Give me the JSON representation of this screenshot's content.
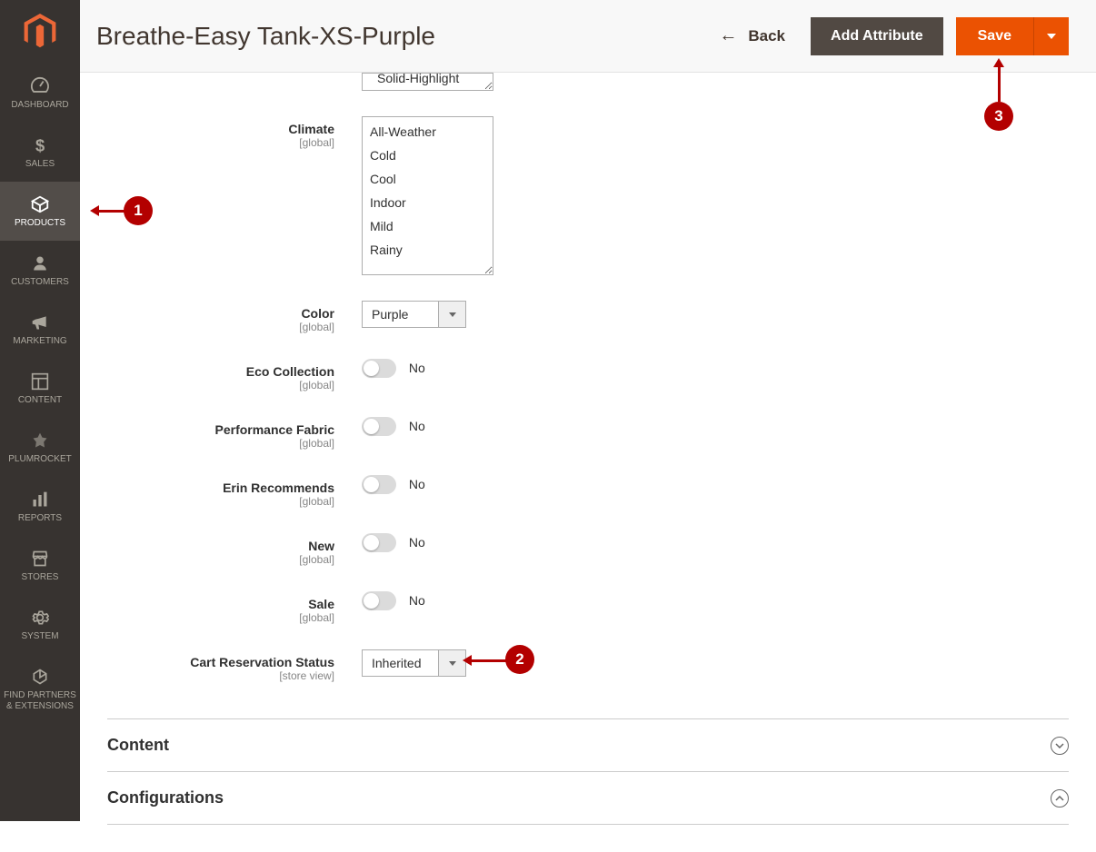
{
  "sidebar": {
    "items": [
      {
        "label": "DASHBOARD"
      },
      {
        "label": "SALES"
      },
      {
        "label": "PRODUCTS"
      },
      {
        "label": "CUSTOMERS"
      },
      {
        "label": "MARKETING"
      },
      {
        "label": "CONTENT"
      },
      {
        "label": "PLUMROCKET"
      },
      {
        "label": "REPORTS"
      },
      {
        "label": "STORES"
      },
      {
        "label": "SYSTEM"
      },
      {
        "label": "FIND PARTNERS & EXTENSIONS"
      }
    ]
  },
  "header": {
    "title": "Breathe-Easy Tank-XS-Purple",
    "back": "Back",
    "addAttribute": "Add Attribute",
    "save": "Save"
  },
  "form": {
    "styles": {
      "visibleOption": "Solid-Highlight"
    },
    "climate": {
      "label": "Climate",
      "scope": "[global]",
      "options": [
        "All-Weather",
        "Cold",
        "Cool",
        "Indoor",
        "Mild",
        "Rainy"
      ]
    },
    "color": {
      "label": "Color",
      "scope": "[global]",
      "value": "Purple"
    },
    "eco": {
      "label": "Eco Collection",
      "scope": "[global]",
      "value": "No"
    },
    "perf": {
      "label": "Performance Fabric",
      "scope": "[global]",
      "value": "No"
    },
    "erin": {
      "label": "Erin Recommends",
      "scope": "[global]",
      "value": "No"
    },
    "new": {
      "label": "New",
      "scope": "[global]",
      "value": "No"
    },
    "sale": {
      "label": "Sale",
      "scope": "[global]",
      "value": "No"
    },
    "cart": {
      "label": "Cart Reservation Status",
      "scope": "[store view]",
      "value": "Inherited"
    }
  },
  "sections": {
    "content": "Content",
    "config": "Configurations"
  },
  "annotations": {
    "one": "1",
    "two": "2",
    "three": "3"
  }
}
